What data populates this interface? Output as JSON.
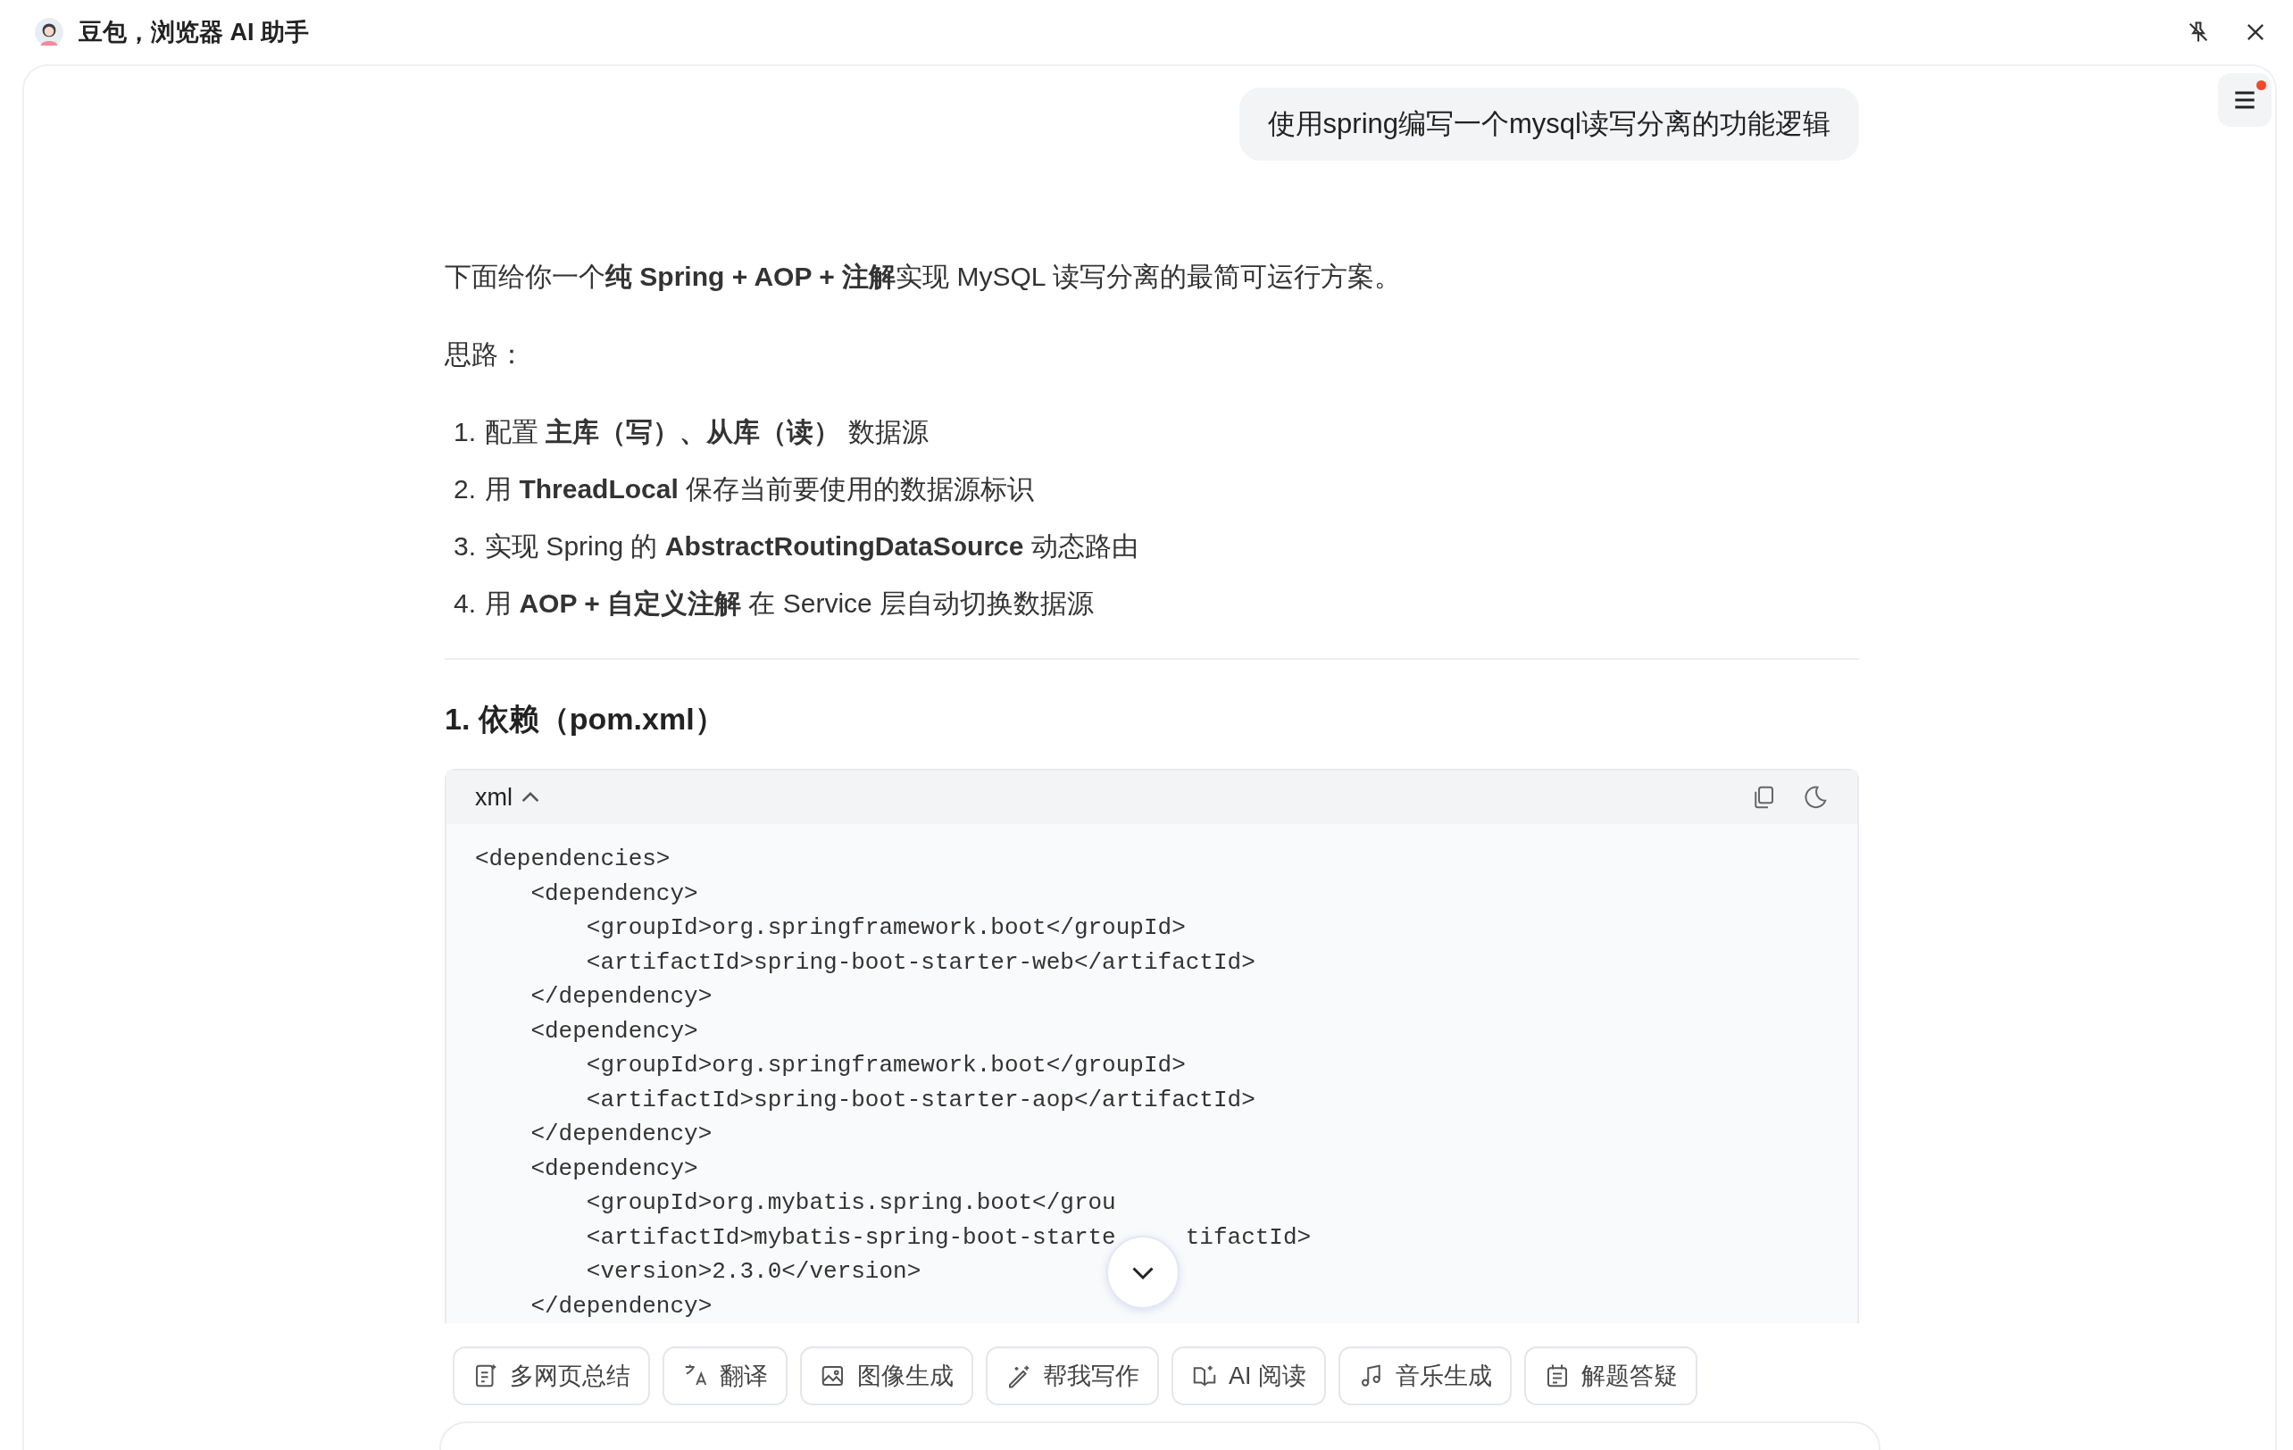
{
  "window": {
    "title": "豆包，浏览器 AI 助手"
  },
  "messages": [
    {
      "kind": "user",
      "text": "使用spring编写一个mysql读写分离的功能逻辑"
    }
  ],
  "answer": {
    "intro": "下面给你一个**纯 Spring + AOP + 注解**实现 MySQL 读写分离的最简可运行方案。",
    "idea_label": "思路：",
    "steps": [
      {
        "number": "1.",
        "text": "配置 **主库（写）、从库（读）** 数据源"
      },
      {
        "number": "2.",
        "text": "用 **ThreadLocal** 保存当前要使用的数据源标识"
      },
      {
        "number": "3.",
        "text": "实现 Spring 的 **AbstractRoutingDataSource** 动态路由"
      },
      {
        "number": "4.",
        "text": "用 **AOP + 自定义注解** 在 Service 层自动切换数据源"
      }
    ],
    "heading": "1. 依赖（pom.xml）",
    "code": {
      "language": "xml",
      "expanded": true,
      "lines": [
        [
          "<dependencies>"
        ],
        [
          "    <dependency>"
        ],
        [
          "        <groupId>org.springframework.boot</groupId>"
        ],
        [
          "        <artifactId>spring-boot-starter-web</artifactId>"
        ],
        [
          "    </dependency>"
        ],
        [
          "    <dependency>"
        ],
        [
          "        <groupId>org.springframework.boot</groupId>"
        ],
        [
          "        <artifactId>spring-boot-starter-aop</artifactId>"
        ],
        [
          "    </dependency>"
        ],
        [
          "    <dependency>"
        ],
        [
          "        <groupId>org.mybatis.spring.boot</grou"
        ],
        [
          "        <artifactId>mybatis-spring-boot-starte",
          "tifactId>"
        ],
        [
          "        <version>2.3.0</version>"
        ],
        [
          "    </dependency>"
        ]
      ]
    }
  },
  "tools": [
    {
      "kind": "summary",
      "label": "多网页总结"
    },
    {
      "kind": "translate",
      "label": "翻译"
    },
    {
      "kind": "image",
      "label": "图像生成"
    },
    {
      "kind": "write",
      "label": "帮我写作"
    },
    {
      "kind": "read",
      "label": "AI 阅读"
    },
    {
      "kind": "music",
      "label": "音乐生成"
    },
    {
      "kind": "solve",
      "label": "解题答疑"
    }
  ],
  "menu": {
    "unread": true
  }
}
